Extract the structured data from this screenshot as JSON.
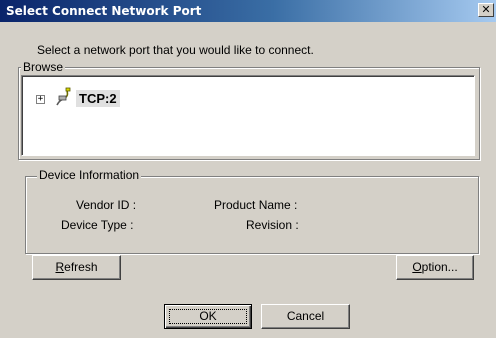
{
  "window": {
    "title": "Select Connect Network Port",
    "close_glyph": "✕"
  },
  "instruction": "Select a network port that you would like to connect.",
  "browse": {
    "legend": "Browse",
    "tree": [
      {
        "expander": "+",
        "icon": "network-port-icon",
        "label": "TCP:2",
        "selected": true
      }
    ]
  },
  "device_info": {
    "legend": "Device Information",
    "vendor_id_label": "Vendor ID :",
    "device_type_label": "Device Type :",
    "product_name_label": "Product Name :",
    "revision_label": "Revision :"
  },
  "buttons": {
    "refresh_underlined": "R",
    "refresh_rest": "efresh",
    "option_underlined": "O",
    "option_rest": "ption...",
    "ok": "OK",
    "cancel": "Cancel"
  },
  "colors": {
    "titlebar_start": "#0a246a",
    "titlebar_end": "#a6caf0",
    "face": "#d4d0c8",
    "selection": "#e0e0e0"
  }
}
